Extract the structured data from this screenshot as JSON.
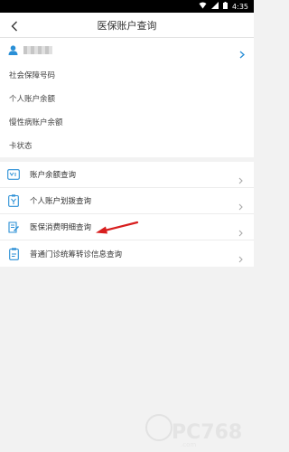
{
  "status_bar": {
    "time": "4:35",
    "icons": [
      "wifi-icon",
      "signal-icon",
      "battery-icon"
    ]
  },
  "header": {
    "title": "医保账户查询",
    "back_icon": "back-arrow-icon"
  },
  "user": {
    "icon": "user-icon",
    "name_masked": true
  },
  "account_info": [
    {
      "label": "社会保障号码"
    },
    {
      "label": "个人账户余额"
    },
    {
      "label": "慢性病账户余额"
    },
    {
      "label": "卡状态"
    }
  ],
  "menu": [
    {
      "label": "账户余额查询",
      "icon": "balance-icon"
    },
    {
      "label": "个人账户划拨查询",
      "icon": "transfer-icon"
    },
    {
      "label": "医保消费明细查询",
      "icon": "receipt-icon"
    },
    {
      "label": "普通门诊统筹转诊信息查询",
      "icon": "clipboard-icon"
    }
  ],
  "colors": {
    "accent": "#2a8fd6",
    "arrow": "#d81e1e",
    "background": "#f2f2f2"
  },
  "watermark": {
    "text": "PC768",
    "icon": "watermark-logo"
  }
}
